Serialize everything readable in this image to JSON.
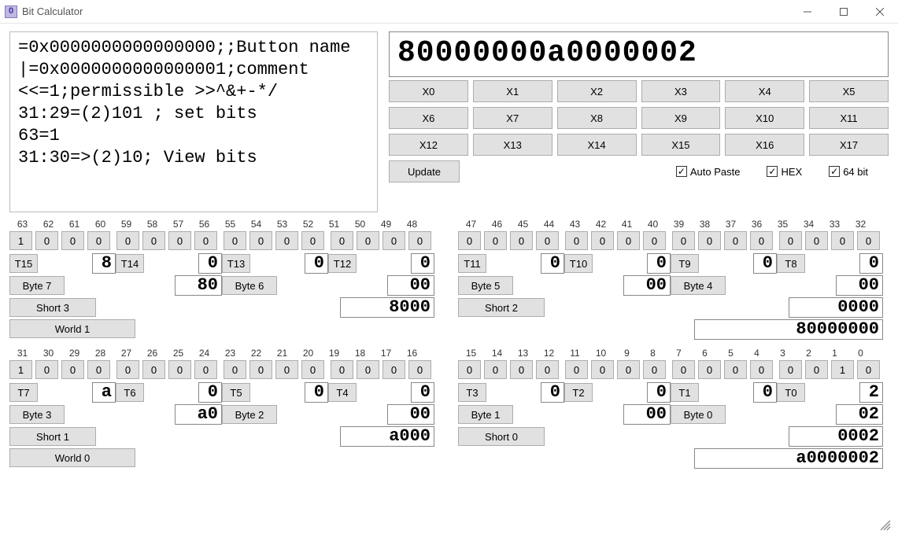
{
  "window": {
    "title": "Bit Calculator",
    "icon_glyph": "0"
  },
  "script": "=0x0000000000000000;;Button name\n|=0x0000000000000001;comment\n<<=1;permissible >>^&+-*/\n31:29=(2)101 ; set bits\n63=1\n31:30=>(2)10; View bits",
  "display": "80000000a0000002",
  "x_buttons": [
    "X0",
    "X1",
    "X2",
    "X3",
    "X4",
    "X5",
    "X6",
    "X7",
    "X8",
    "X9",
    "X10",
    "X11",
    "X12",
    "X13",
    "X14",
    "X15",
    "X16",
    "X17"
  ],
  "update_label": "Update",
  "checkboxes": {
    "auto_paste": {
      "label": "Auto Paste",
      "checked": true
    },
    "hex": {
      "label": "HEX",
      "checked": true
    },
    "bit64": {
      "label": "64 bit",
      "checked": true
    }
  },
  "bit_labels_hi_a": [
    "63",
    "62",
    "61",
    "60",
    "59",
    "58",
    "57",
    "56",
    "55",
    "54",
    "53",
    "52",
    "51",
    "50",
    "49",
    "48"
  ],
  "bit_labels_hi_b": [
    "47",
    "46",
    "45",
    "44",
    "43",
    "42",
    "41",
    "40",
    "39",
    "38",
    "37",
    "36",
    "35",
    "34",
    "33",
    "32"
  ],
  "bit_labels_lo_a": [
    "31",
    "30",
    "29",
    "28",
    "27",
    "26",
    "25",
    "24",
    "23",
    "22",
    "21",
    "20",
    "19",
    "18",
    "17",
    "16"
  ],
  "bit_labels_lo_b": [
    "15",
    "14",
    "13",
    "12",
    "11",
    "10",
    "9",
    "8",
    "7",
    "6",
    "5",
    "4",
    "3",
    "2",
    "1",
    "0"
  ],
  "bits_hi_a": [
    "1",
    "0",
    "0",
    "0",
    "0",
    "0",
    "0",
    "0",
    "0",
    "0",
    "0",
    "0",
    "0",
    "0",
    "0",
    "0"
  ],
  "bits_hi_b": [
    "0",
    "0",
    "0",
    "0",
    "0",
    "0",
    "0",
    "0",
    "0",
    "0",
    "0",
    "0",
    "0",
    "0",
    "0",
    "0"
  ],
  "bits_lo_a": [
    "1",
    "0",
    "0",
    "0",
    "0",
    "0",
    "0",
    "0",
    "0",
    "0",
    "0",
    "0",
    "0",
    "0",
    "0",
    "0"
  ],
  "bits_lo_b": [
    "0",
    "0",
    "0",
    "0",
    "0",
    "0",
    "0",
    "0",
    "0",
    "0",
    "0",
    "0",
    "0",
    "0",
    "1",
    "0"
  ],
  "t_btns": {
    "15": "T15",
    "14": "T14",
    "13": "T13",
    "12": "T12",
    "11": "T11",
    "10": "T10",
    "9": "T9",
    "8": "T8",
    "7": "T7",
    "6": "T6",
    "5": "T5",
    "4": "T4",
    "3": "T3",
    "2": "T2",
    "1": "T1",
    "0": "T0"
  },
  "nibbles": {
    "15": "8",
    "14": "0",
    "13": "0",
    "12": "0",
    "11": "0",
    "10": "0",
    "9": "0",
    "8": "0",
    "7": "a",
    "6": "0",
    "5": "0",
    "4": "0",
    "3": "0",
    "2": "0",
    "1": "0",
    "0": "2"
  },
  "byte_btns": {
    "7": "Byte 7",
    "6": "Byte 6",
    "5": "Byte 5",
    "4": "Byte 4",
    "3": "Byte 3",
    "2": "Byte 2",
    "1": "Byte 1",
    "0": "Byte 0"
  },
  "bytes": {
    "7": "80",
    "6": "00",
    "5": "00",
    "4": "00",
    "3": "a0",
    "2": "00",
    "1": "00",
    "0": "02"
  },
  "short_btns": {
    "3": "Short 3",
    "2": "Short 2",
    "1": "Short 1",
    "0": "Short 0"
  },
  "shorts": {
    "3": "8000",
    "2": "0000",
    "1": "a000",
    "0": "0002"
  },
  "world_btns": {
    "1": "World 1",
    "0": "World 0"
  },
  "worlds": {
    "1": "80000000",
    "0": "a0000002"
  }
}
